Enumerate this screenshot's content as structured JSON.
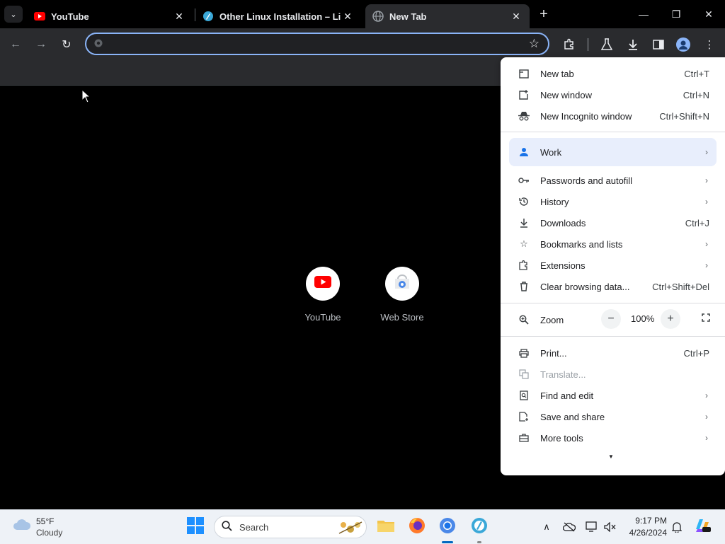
{
  "tabs": [
    {
      "title": "YouTube",
      "favicon": "youtube-icon",
      "active": false
    },
    {
      "title": "Other Linux Installation – Libre",
      "favicon": "libreelec-icon",
      "active": false
    },
    {
      "title": "New Tab",
      "favicon": "globe-icon",
      "active": true
    }
  ],
  "omnibox": {
    "value": "",
    "placeholder": ""
  },
  "shortcuts": [
    {
      "label": "YouTube",
      "icon": "youtube-icon"
    },
    {
      "label": "Web Store",
      "icon": "web-store-icon"
    }
  ],
  "menu": {
    "new_tab": {
      "label": "New tab",
      "shortcut": "Ctrl+T"
    },
    "new_window": {
      "label": "New window",
      "shortcut": "Ctrl+N"
    },
    "new_incognito": {
      "label": "New Incognito window",
      "shortcut": "Ctrl+Shift+N"
    },
    "profile": {
      "label": "Work"
    },
    "passwords": {
      "label": "Passwords and autofill"
    },
    "history": {
      "label": "History"
    },
    "downloads": {
      "label": "Downloads",
      "shortcut": "Ctrl+J"
    },
    "bookmarks": {
      "label": "Bookmarks and lists"
    },
    "extensions": {
      "label": "Extensions"
    },
    "clear_data": {
      "label": "Clear browsing data...",
      "shortcut": "Ctrl+Shift+Del"
    },
    "zoom": {
      "label": "Zoom",
      "minus": "−",
      "level": "100%",
      "plus": "+"
    },
    "print": {
      "label": "Print...",
      "shortcut": "Ctrl+P"
    },
    "translate": {
      "label": "Translate..."
    },
    "find_edit": {
      "label": "Find and edit"
    },
    "save_share": {
      "label": "Save and share"
    },
    "more_tools": {
      "label": "More tools"
    }
  },
  "taskbar": {
    "weather_temp": "55°F",
    "weather_condition": "Cloudy",
    "search_label": "Search",
    "time": "9:17 PM",
    "date": "4/26/2024"
  },
  "colors": {
    "accent": "#8ab4f8",
    "menu_bg": "#ffffff",
    "youtube_red": "#ff0000",
    "taskbar_active": "#0067c0"
  }
}
